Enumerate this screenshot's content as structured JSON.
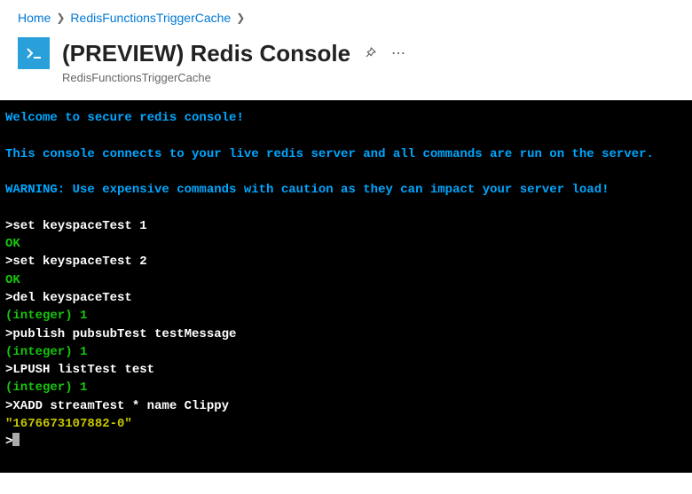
{
  "breadcrumb": {
    "home": "Home",
    "resource": "RedisFunctionsTriggerCache"
  },
  "header": {
    "title": "(PREVIEW) Redis Console",
    "subtitle": "RedisFunctionsTriggerCache"
  },
  "console": {
    "intro1": "Welcome to secure redis console!",
    "intro2": "This console connects to your live redis server and all commands are run on the server.",
    "intro3": "WARNING: Use expensive commands with caution as they can impact your server load!",
    "lines": [
      {
        "kind": "cmd",
        "text": ">set keyspaceTest 1"
      },
      {
        "kind": "ok",
        "text": "OK"
      },
      {
        "kind": "cmd",
        "text": ">set keyspaceTest 2"
      },
      {
        "kind": "ok",
        "text": "OK"
      },
      {
        "kind": "cmd",
        "text": ">del keyspaceTest"
      },
      {
        "kind": "int",
        "text": "(integer) 1"
      },
      {
        "kind": "cmd",
        "text": ">publish pubsubTest testMessage"
      },
      {
        "kind": "int",
        "text": "(integer) 1"
      },
      {
        "kind": "cmd",
        "text": ">LPUSH listTest test"
      },
      {
        "kind": "int",
        "text": "(integer) 1"
      },
      {
        "kind": "cmd",
        "text": ">XADD streamTest * name Clippy"
      },
      {
        "kind": "str",
        "text": "\"1676673107882-0\""
      }
    ],
    "prompt": ">"
  }
}
